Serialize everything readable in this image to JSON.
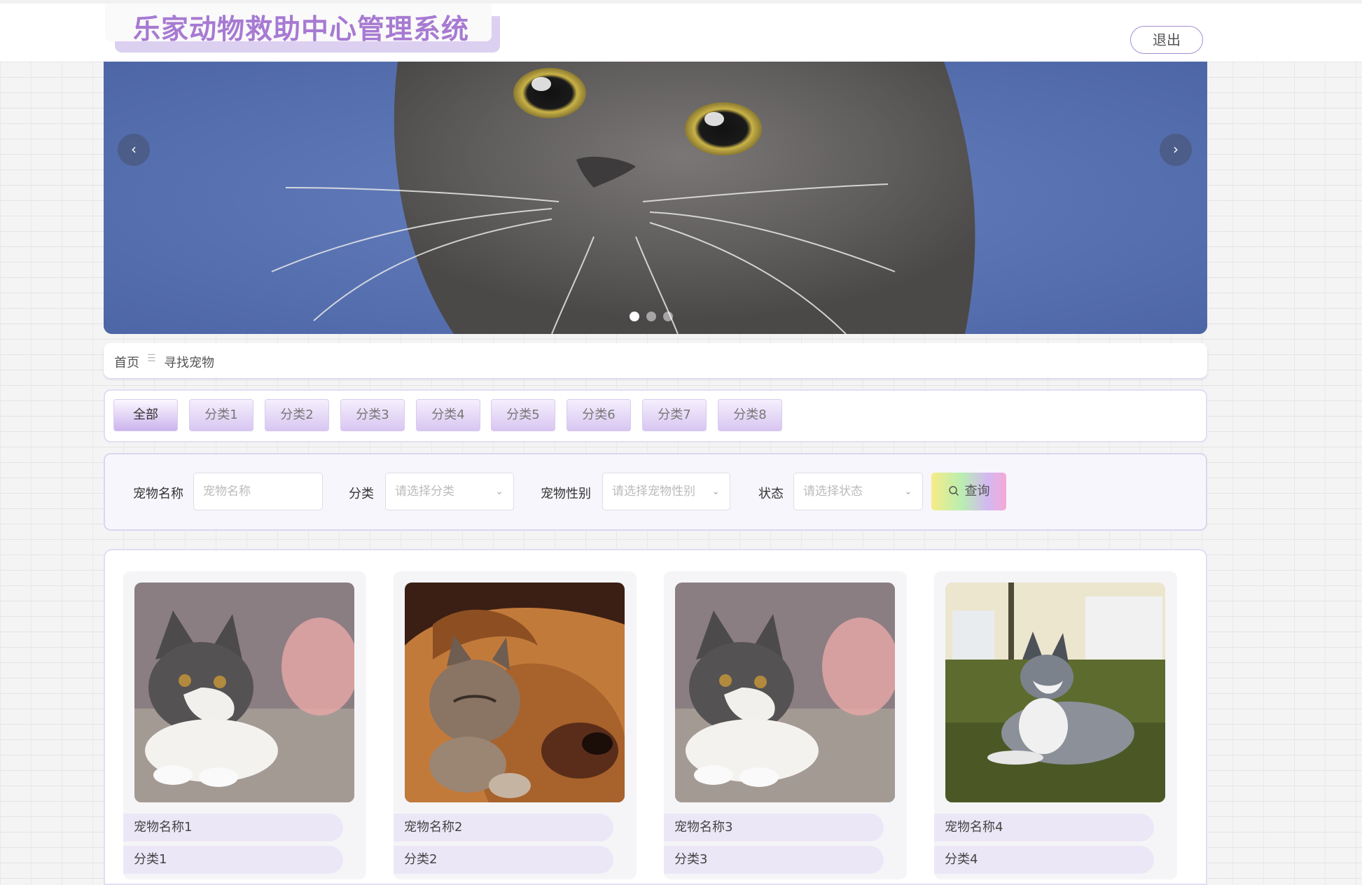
{
  "header": {
    "title": "乐家动物救助中心管理系统",
    "logout_label": "退出"
  },
  "banner": {
    "prev_icon": "‹",
    "next_icon": "›",
    "slide_count": 3,
    "active_slide": 1
  },
  "breadcrumb": {
    "home": "首页",
    "separator": "☰",
    "current": "寻找宠物"
  },
  "category_tabs": [
    "全部",
    "分类1",
    "分类2",
    "分类3",
    "分类4",
    "分类5",
    "分类6",
    "分类7",
    "分类8"
  ],
  "filters": {
    "name_label": "宠物名称",
    "name_placeholder": "宠物名称",
    "category_label": "分类",
    "category_placeholder": "请选择分类",
    "gender_label": "宠物性别",
    "gender_placeholder": "请选择宠物性别",
    "status_label": "状态",
    "status_placeholder": "请选择状态",
    "search_label": "查询"
  },
  "pets": [
    {
      "name": "宠物名称1",
      "category": "分类1",
      "image": "cat-on-sofa"
    },
    {
      "name": "宠物名称2",
      "category": "分类2",
      "image": "kitten-with-dog"
    },
    {
      "name": "宠物名称3",
      "category": "分类3",
      "image": "cat-on-sofa"
    },
    {
      "name": "宠物名称4",
      "category": "分类4",
      "image": "husky-on-grass"
    }
  ],
  "colors": {
    "accent": "#a77ad2",
    "tab_gradient_end": "#d8c6f1",
    "pill_bg": "#ece7f7"
  }
}
